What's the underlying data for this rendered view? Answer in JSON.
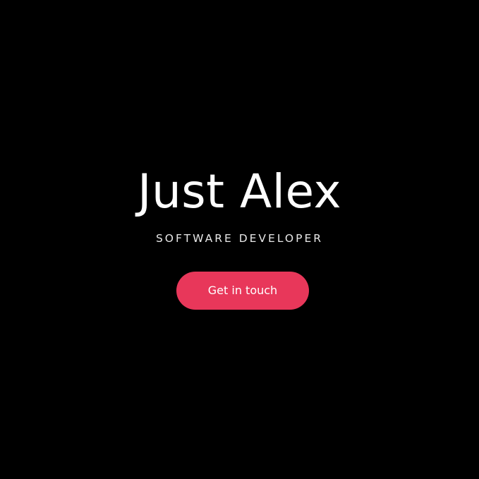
{
  "hero": {
    "title": "Just Alex",
    "subtitle": "SOFTWARE DEVELOPER",
    "cta_label": "Get in touch"
  },
  "colors": {
    "background": "#000000",
    "title": "#ffffff",
    "subtitle": "#e8e8e8",
    "accent": "#e8375a"
  }
}
